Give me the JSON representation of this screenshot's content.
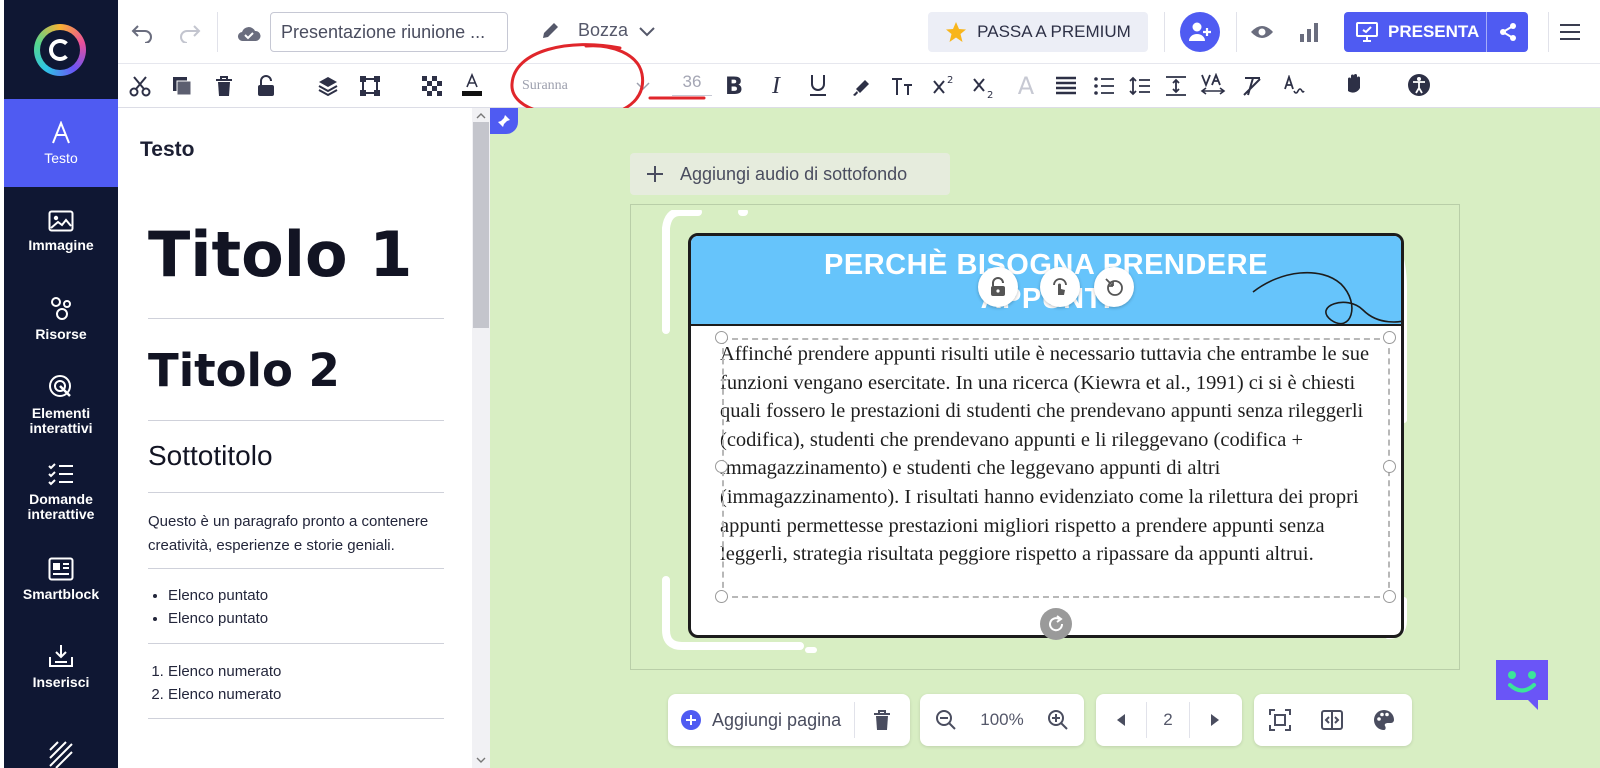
{
  "nav": {
    "items": [
      {
        "label": "Testo",
        "icon": "text-icon"
      },
      {
        "label": "Immagine",
        "icon": "image-icon"
      },
      {
        "label": "Risorse",
        "icon": "resources-icon"
      },
      {
        "label": "Elementi interattivi",
        "icon": "interactive-elements-icon"
      },
      {
        "label": "Domande interattive",
        "icon": "interactive-questions-icon"
      },
      {
        "label": "Smartblock",
        "icon": "smartblock-icon"
      },
      {
        "label": "Inserisci",
        "icon": "insert-icon"
      }
    ]
  },
  "header": {
    "title_value": "Presentazione riunione ...",
    "status": "Bozza",
    "premium_label": "PASSA A PREMIUM",
    "present_label": "PRESENTA"
  },
  "format": {
    "font_family": "Suranna",
    "font_size": "36"
  },
  "panel": {
    "title": "Testo",
    "heading1": "Titolo 1",
    "heading2": "Titolo 2",
    "subtitle": "Sottotitolo",
    "paragraph": "Questo è un paragrafo pronto a contenere creatività, esperienze e storie geniali.",
    "bullets": [
      "Elenco puntato",
      "Elenco puntato"
    ],
    "numbered": [
      "Elenco numerato",
      "Elenco numerato"
    ]
  },
  "canvas": {
    "add_audio_label": "Aggiungi audio di sottofondo",
    "card_title_line1": "PERCHÈ BISOGNA PRENDERE",
    "card_title_line2": "APPUNTI",
    "body_text": "Affinché prendere appunti risulti utile è necessario tuttavia che entrambe le sue funzioni vengano esercitate. In una ricerca (Kiewra et al., 1991) ci si è chiesti quali fossero le prestazioni di studenti che prendevano appunti senza rileggerli (codifica), studenti che prendevano appunti e li rileggevano (codifica + immagazzinamento) e studenti che leggevano appunti di altri (immagazzinamento). I risultati hanno evidenziato come la rilettura dei propri appunti permettesse prestazioni migliori rispetto a prendere appunti senza leggerli, strategia risultata peggiore rispetto a ripassare da appunti altrui."
  },
  "bottom": {
    "add_page_label": "Aggiungi pagina",
    "zoom": "100%",
    "page": "2"
  },
  "colors": {
    "accent": "#4f5bf2",
    "nav_bg": "#0f1733",
    "canvas_bg": "#d8eec3",
    "card_header": "#66c4fb",
    "annotation": "#e0262b"
  }
}
